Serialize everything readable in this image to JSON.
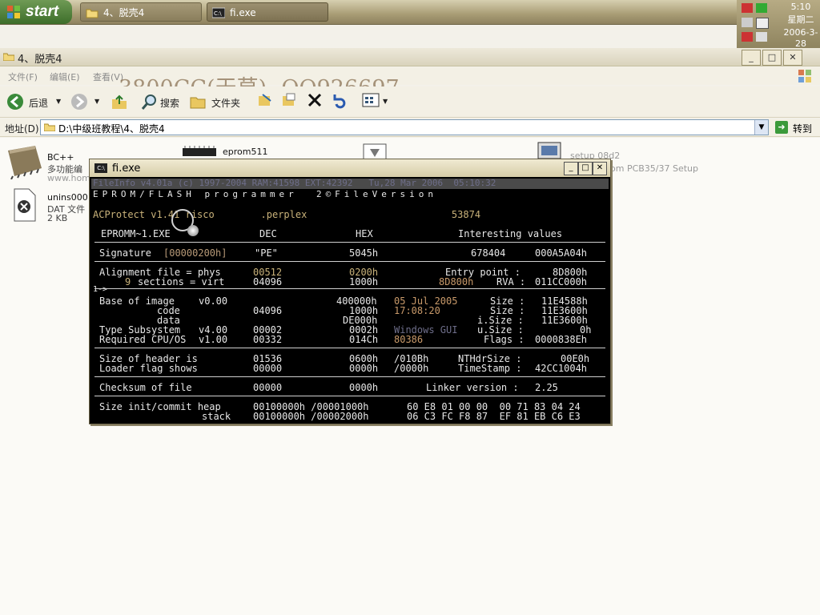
{
  "taskbar": {
    "start_label": "start",
    "tasks": [
      {
        "label": "4、脱壳4"
      },
      {
        "label": "fi.exe"
      }
    ],
    "clock": {
      "time": "5:10",
      "weekday": "星期二",
      "date": "2006-3-28"
    }
  },
  "explorer": {
    "title": "4、脱壳4",
    "menu": [
      "文件(F)",
      "编辑(E)",
      "查看(V)"
    ],
    "watermark": "3800CC(天草)--QQ926697",
    "toolbar": {
      "back": "后退",
      "search": "搜索",
      "folders": "文件夹"
    },
    "address": {
      "label": "地址(D)",
      "value": "D:\\中级班教程\\4、脱壳4",
      "go": "转到"
    },
    "files": [
      {
        "name": "BC++",
        "sub": "多功能编",
        "sub2": "www.home"
      },
      {
        "name": "eprom511"
      },
      {
        "name": "setup 08d2",
        "sub": "om PCB35/37 Setup"
      },
      {
        "name": "unins000",
        "sub": "DAT 文件",
        "sub2": "2 KB"
      }
    ]
  },
  "console": {
    "title": "fi.exe",
    "line_header": "FileInfo v4.01a (c) 1997-2004 RAM:41598 EXT:42392   Tu,28 Mar 2006  05:10:32",
    "line_banner": "EPROM/FLASH programmer  2©FileVersion",
    "line_protector": "ACProtect v1.41 risco        .perplex                         53874",
    "col_file": "EPROMM~1.EXE",
    "col_dec": "DEC",
    "col_hex": "HEX",
    "col_interesting": "Interesting values",
    "signature": {
      "label": "Signature",
      "offset": "[00000200h]",
      "dec": "\"PE\"",
      "hex": "5045h",
      "v1": "678404",
      "v2": "000A5A04h"
    },
    "alignment": {
      "label": "Alignment file = phys",
      "dec": "00512",
      "hex": "0200h",
      "right_label": "Entry point :",
      "right_val": "8D800h"
    },
    "sections": {
      "count": "9",
      "label": "sections = virt",
      "dec": "04096",
      "hex": "1000h",
      "mid": "8D800h",
      "right_label": "RVA :",
      "right_val": "011CC000h"
    },
    "marker": "1->",
    "base": {
      "label": "Base of image",
      "ver": "v0.00",
      "hex": "400000h",
      "date": "05 Jul 2005",
      "right_label": "Size :",
      "right_val": "11E4588h"
    },
    "code": {
      "label": "code",
      "dec": "04096",
      "hex": "1000h",
      "time": "17:08:20",
      "right_label": "Size :",
      "right_val": "11E3600h"
    },
    "data": {
      "label": "data",
      "hex": "DE000h",
      "right_label": "i.Size :",
      "right_val": "11E3600h"
    },
    "subsystem": {
      "label": "Type Subsystem",
      "ver": "v4.00",
      "dec": "00002",
      "hex": "0002h",
      "mid": "Windows GUI",
      "right_label": "u.Size :",
      "right_val": "0h"
    },
    "cpu": {
      "label": "Required CPU/OS",
      "ver": "v1.00",
      "dec": "00332",
      "hex": "014Ch",
      "mid": "80386",
      "right_label": "Flags :",
      "right_val": "0000838Eh"
    },
    "header_size": {
      "label": "Size of header is",
      "dec": "01536",
      "hex": "0600h",
      "mid": "/010Bh",
      "right_label": "NTHdrSize :",
      "right_val": "00E0h"
    },
    "loader": {
      "label": "Loader flag shows",
      "dec": "00000",
      "hex": "0000h",
      "mid": "/0000h",
      "right_label": "TimeStamp :",
      "right_val": "42CC1004h"
    },
    "checksum": {
      "label": "Checksum of file",
      "dec": "00000",
      "hex": "0000h",
      "right_label": "Linker version :",
      "right_val": "2.25"
    },
    "heap": {
      "label": "Size init/commit heap",
      "vals": "00100000h /00001000h",
      "bytes": "60 E8 01 00 00  00 71 83 04 24"
    },
    "stack": {
      "label": "stack",
      "vals": "00100000h /00002000h",
      "bytes": "06 C3 FC F8 87  EF 81 EB C6 E3"
    }
  },
  "colors": {
    "console_bg": "#000000",
    "console_fg": "#d6d6d6",
    "accent": "#c9b27a",
    "taskbar": "#a89c74"
  },
  "icons": [
    "windows-flag-icon",
    "folder-icon",
    "console-icon",
    "back-arrow-icon",
    "forward-arrow-icon",
    "up-folder-icon",
    "search-icon",
    "folders-icon",
    "move-icon",
    "copy-icon",
    "delete-icon",
    "undo-icon",
    "views-icon",
    "go-arrow-icon"
  ]
}
